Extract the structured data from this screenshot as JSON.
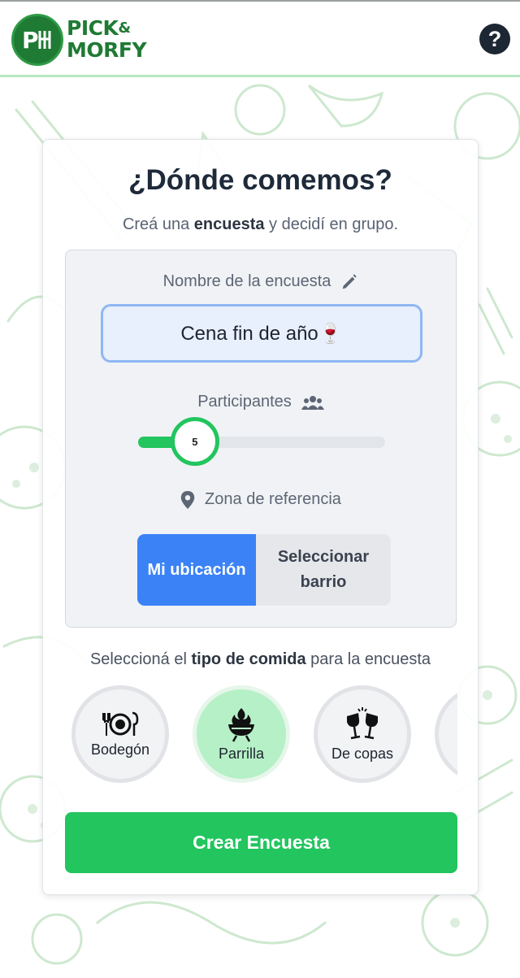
{
  "header": {
    "brand_line1": "PICK",
    "brand_amp": "&",
    "brand_line2": "MORFY",
    "help_label": "?"
  },
  "card": {
    "title": "¿Dónde comemos?",
    "subtitle_pre": "Creá una ",
    "subtitle_bold": "encuesta",
    "subtitle_post": " y decidí en grupo."
  },
  "form": {
    "name_label": "Nombre de la encuesta",
    "name_value": "Cena fin de año🍷",
    "participants_label": "Participantes",
    "participants_value": "5",
    "participants_fraction": 0.23,
    "zone_label": "Zona de referencia",
    "zone_options": [
      {
        "label": "Mi ubicación",
        "selected": true
      },
      {
        "label": "Seleccionar barrio",
        "selected": false
      }
    ]
  },
  "food": {
    "label_pre": "Seleccioná el ",
    "label_bold": "tipo de comida",
    "label_post": " para la encuesta",
    "options": [
      {
        "label": "Bodegón",
        "icon": "plate-cutlery-icon",
        "selected": false
      },
      {
        "label": "Parrilla",
        "icon": "grill-icon",
        "selected": true
      },
      {
        "label": "De copas",
        "icon": "wine-glasses-icon",
        "selected": false
      }
    ]
  },
  "create_label": "Crear Encuesta",
  "colors": {
    "brand": "#1f7a34",
    "accent": "#22c55e",
    "selected_segment": "#3b82f6"
  }
}
